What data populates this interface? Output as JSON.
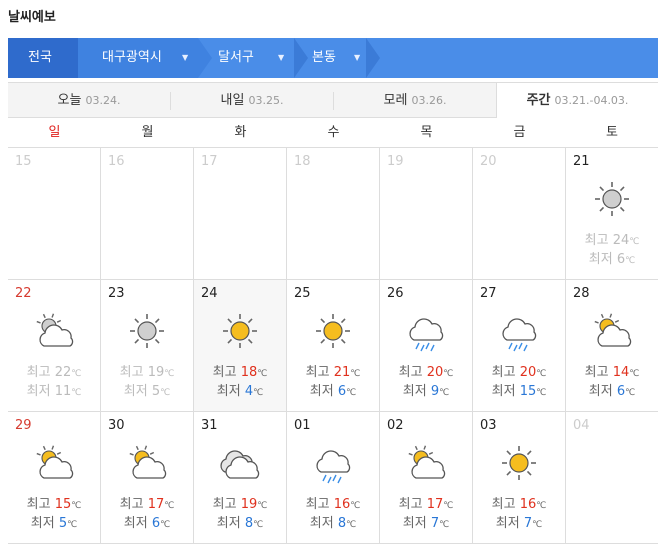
{
  "page": {
    "title": "날씨예보"
  },
  "breadcrumb": {
    "country": "전국",
    "city": "대구광역시",
    "district": "달서구",
    "dong": "본동"
  },
  "tabs": [
    {
      "label": "오늘",
      "date": "03.24."
    },
    {
      "label": "내일",
      "date": "03.25."
    },
    {
      "label": "모레",
      "date": "03.26."
    },
    {
      "label": "주간",
      "date": "03.21.-04.03."
    }
  ],
  "weekdays": [
    "일",
    "월",
    "화",
    "수",
    "목",
    "금",
    "토"
  ],
  "temp_labels": {
    "high": "최고",
    "low": "최저",
    "unit": "℃"
  },
  "calendar": [
    {
      "day": "15",
      "icon": "none"
    },
    {
      "day": "16",
      "icon": "none"
    },
    {
      "day": "17",
      "icon": "none"
    },
    {
      "day": "18",
      "icon": "none"
    },
    {
      "day": "19",
      "icon": "none"
    },
    {
      "day": "20",
      "icon": "none"
    },
    {
      "day": "21",
      "icon": "sun-icon",
      "high": "24",
      "low": "6"
    },
    {
      "day": "22",
      "icon": "partly-cloudy-icon",
      "high": "22",
      "low": "11"
    },
    {
      "day": "23",
      "icon": "sun-icon",
      "high": "19",
      "low": "5"
    },
    {
      "day": "24",
      "icon": "sun-icon",
      "high": "18",
      "low": "4"
    },
    {
      "day": "25",
      "icon": "sun-icon",
      "high": "21",
      "low": "6"
    },
    {
      "day": "26",
      "icon": "rain-icon",
      "high": "20",
      "low": "9"
    },
    {
      "day": "27",
      "icon": "rain-icon",
      "high": "20",
      "low": "15"
    },
    {
      "day": "28",
      "icon": "partly-cloudy-icon",
      "high": "14",
      "low": "6"
    },
    {
      "day": "29",
      "icon": "partly-cloudy-icon",
      "high": "15",
      "low": "5"
    },
    {
      "day": "30",
      "icon": "partly-cloudy-icon",
      "high": "17",
      "low": "6"
    },
    {
      "day": "31",
      "icon": "cloudy-icon",
      "high": "19",
      "low": "8"
    },
    {
      "day": "01",
      "icon": "rain-icon",
      "high": "16",
      "low": "8"
    },
    {
      "day": "02",
      "icon": "partly-cloudy-icon",
      "high": "17",
      "low": "7"
    },
    {
      "day": "03",
      "icon": "sun-icon",
      "high": "16",
      "low": "7"
    },
    {
      "day": "04",
      "icon": "none"
    }
  ],
  "colors": {
    "bar": "#4a8de8",
    "high": "#e0311e",
    "low": "#2a77d6",
    "sunday": "#d63a2f"
  }
}
